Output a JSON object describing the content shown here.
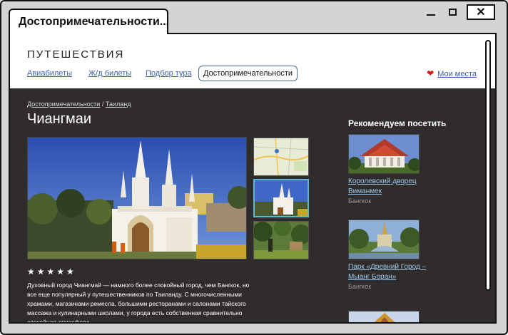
{
  "window": {
    "tab_title": "Достопримечательности...",
    "close_label": "✕"
  },
  "site": {
    "brand": "ПУТЕШЕСТВИЯ",
    "nav": [
      {
        "label": "Авиабилеты"
      },
      {
        "label": "Ж/д билеты"
      },
      {
        "label": "Подбор тура"
      },
      {
        "label": "Достопримечательности",
        "active": true
      }
    ],
    "my_places": "Мои места"
  },
  "breadcrumbs": [
    {
      "label": "Достопримечательности"
    },
    {
      "separator": "/"
    },
    {
      "label": "Таиланд"
    }
  ],
  "page": {
    "title": "Чиангмаи",
    "rating_stars": "★★★★★",
    "rating": 5,
    "description": "Духовный город Чиангмай — намного более спокойный город, чем Бангкок, но все еще популярный у путешественников по Таиланду. С многочисленными храмами, магазинами ремесла, большими ресторанами и салонами тайского массажа и кулинарными школами, у города есть собственная сравнительно спокойная атмосфера."
  },
  "gallery": {
    "thumbnails": [
      "map-thumbnail",
      "temple-thumbnail",
      "forest-thumbnail"
    ],
    "selected_index": 1
  },
  "recommendations": {
    "title": "Рекомендуем посетить",
    "items": [
      {
        "name": "Королевский дворец Виманмек",
        "city": "Бангкок"
      },
      {
        "name": "Парк «Древний Город – Мыанг Боран»",
        "city": "Бангкок"
      }
    ]
  },
  "colors": {
    "dark_background": "#2f2c2b",
    "link": "#3a5fb0",
    "heart": "#d01818",
    "selected_thumb_border": "#5ab8d6"
  }
}
